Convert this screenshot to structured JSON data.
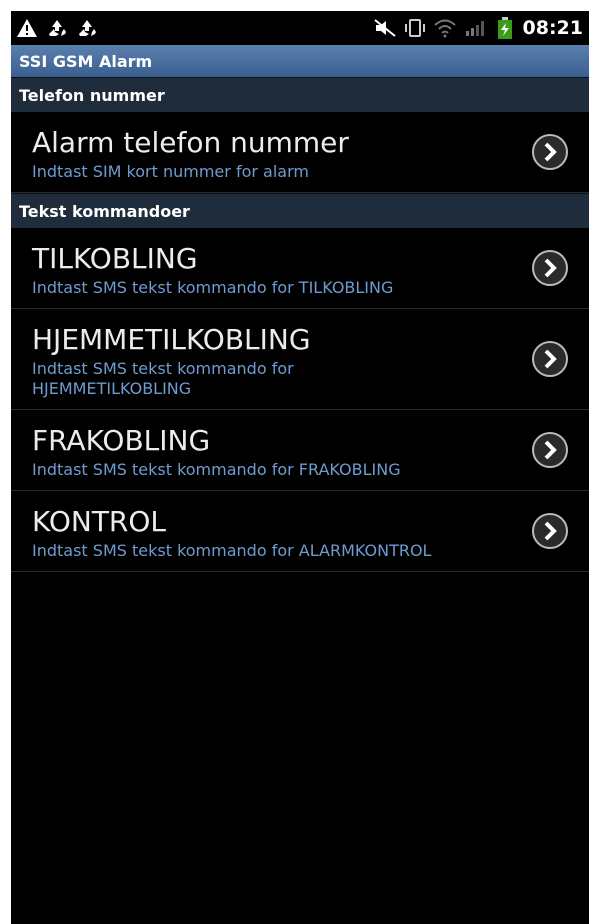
{
  "status_bar": {
    "left_icons": [
      "warning-icon",
      "recycle-icon",
      "recycle-icon"
    ],
    "right_icons": [
      "mute-icon",
      "vibrate-icon",
      "wifi-icon",
      "signal-icon",
      "battery-charging-icon"
    ],
    "time": "08:21"
  },
  "app": {
    "title": "SSI GSM Alarm"
  },
  "sections": [
    {
      "header": "Telefon nummer",
      "items": [
        {
          "title": "Alarm telefon nummer",
          "subtitle": "Indtast SIM kort nummer for alarm"
        }
      ]
    },
    {
      "header": "Tekst kommandoer",
      "items": [
        {
          "title": "TILKOBLING",
          "subtitle": "Indtast SMS tekst kommando for TILKOBLING"
        },
        {
          "title": "HJEMMETILKOBLING",
          "subtitle": "Indtast SMS tekst kommando for HJEMMETILKOBLING"
        },
        {
          "title": "FRAKOBLING",
          "subtitle": "Indtast SMS tekst kommando for FRAKOBLING"
        },
        {
          "title": "KONTROL",
          "subtitle": "Indtast SMS tekst kommando for ALARMKONTROL"
        }
      ]
    }
  ],
  "colors": {
    "title_bar": "#4a6f9e",
    "section_header": "#1f2c3c",
    "subtitle": "#6f9bcf"
  }
}
